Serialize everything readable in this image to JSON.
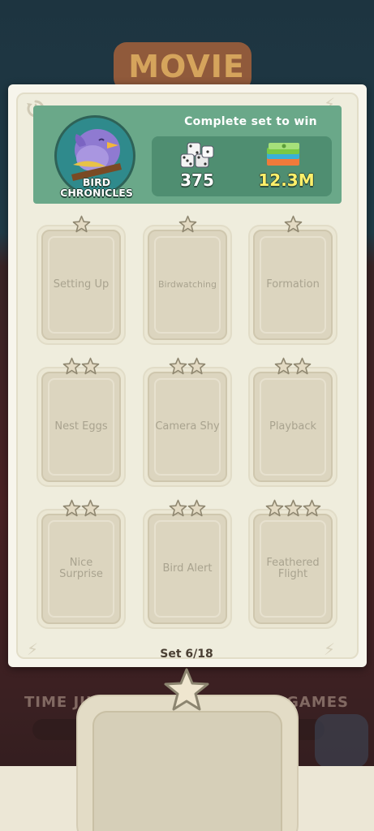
{
  "background": {
    "banner_text": "MOVIE",
    "strip_left": "TIME JUMP",
    "strip_right": "GAMES"
  },
  "album": {
    "name_line1": "BIRD",
    "name_line2": "CHRONICLES"
  },
  "header": {
    "title": "Complete set to win",
    "rewards": {
      "dice_icon": "dice-icon",
      "dice_value": "375",
      "cash_icon": "cash-stack-icon",
      "cash_value": "12.3M"
    }
  },
  "cards": [
    {
      "name": "Setting Up",
      "stars": 1
    },
    {
      "name": "Birdwatching",
      "stars": 1
    },
    {
      "name": "Formation",
      "stars": 1
    },
    {
      "name": "Nest Eggs",
      "stars": 2
    },
    {
      "name": "Camera Shy",
      "stars": 2
    },
    {
      "name": "Playback",
      "stars": 2
    },
    {
      "name": "Nice Surprise",
      "stars": 2
    },
    {
      "name": "Bird Alert",
      "stars": 2
    },
    {
      "name": "Feathered Flight",
      "stars": 3
    }
  ],
  "footer": {
    "set_label": "Set 6/18"
  },
  "colors": {
    "header_green": "#6aa889",
    "card_bg": "#efeddd",
    "star_fill": "#e3dac3"
  }
}
